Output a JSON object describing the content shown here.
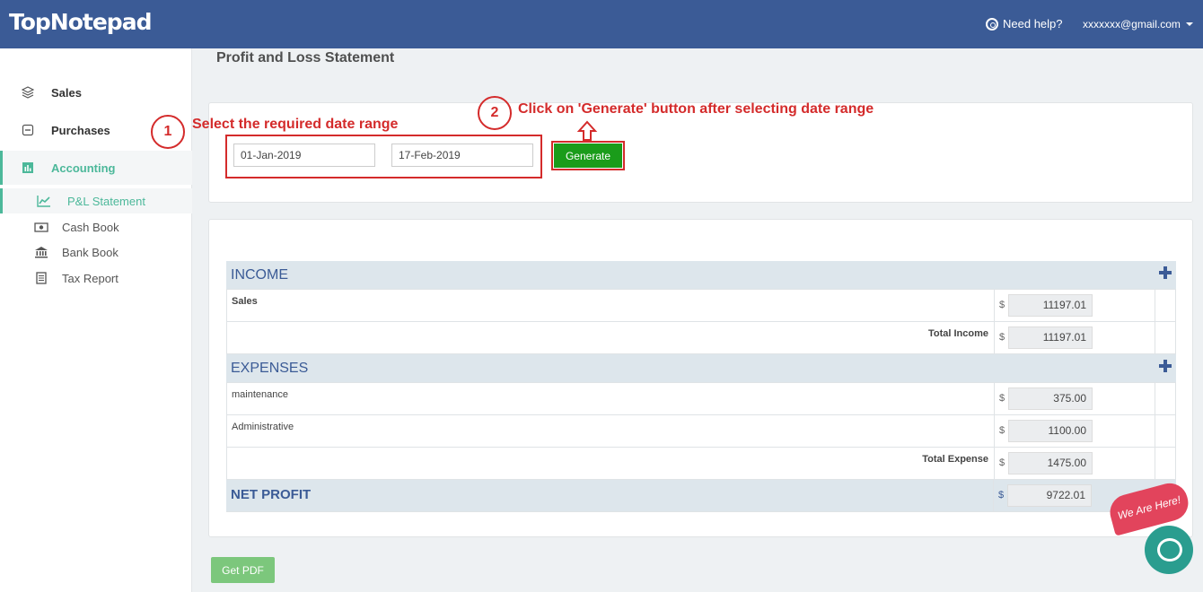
{
  "app": {
    "brand": "TopNotepad"
  },
  "header": {
    "help_label": "Need help?",
    "user_email": "xxxxxxx@gmail.com"
  },
  "sidebar": {
    "items": [
      {
        "label": "Sales",
        "icon": "layers-icon"
      },
      {
        "label": "Purchases",
        "icon": "minus-square-icon"
      },
      {
        "label": "Accounting",
        "icon": "bar-chart-icon",
        "active": true
      }
    ],
    "subitems": [
      {
        "label": "P&L Statement",
        "icon": "line-chart-icon",
        "active": true
      },
      {
        "label": "Cash Book",
        "icon": "money-icon"
      },
      {
        "label": "Bank Book",
        "icon": "bank-icon"
      },
      {
        "label": "Tax Report",
        "icon": "document-icon"
      }
    ]
  },
  "page": {
    "title": "Profit and Loss Statement"
  },
  "filters": {
    "start_date": "01-Jan-2019",
    "end_date": "17-Feb-2019",
    "generate_label": "Generate"
  },
  "annotations": {
    "step1_num": "1",
    "step1_text": "Select the required date range",
    "step2_num": "2",
    "step2_text": "Click on 'Generate' button after selecting date range",
    "color": "#d42b2b"
  },
  "report": {
    "currency": "$",
    "income": {
      "title": "INCOME",
      "items": [
        {
          "label": "Sales",
          "value": "11197.01"
        }
      ],
      "total_label": "Total Income",
      "total_value": "11197.01"
    },
    "expenses": {
      "title": "EXPENSES",
      "items": [
        {
          "label": "maintenance",
          "value": "375.00"
        },
        {
          "label": "Administrative",
          "value": "1100.00"
        }
      ],
      "total_label": "Total Expense",
      "total_value": "1475.00"
    },
    "net": {
      "label": "NET PROFIT",
      "value": "9722.01"
    }
  },
  "actions": {
    "pdf_label": "Get PDF"
  },
  "chat": {
    "badge_text": "We Are Here!"
  },
  "colors": {
    "header": "#3b5b96",
    "accent": "#4cb89a",
    "generate": "#1a9c1a",
    "pdf": "#7cc77c"
  }
}
